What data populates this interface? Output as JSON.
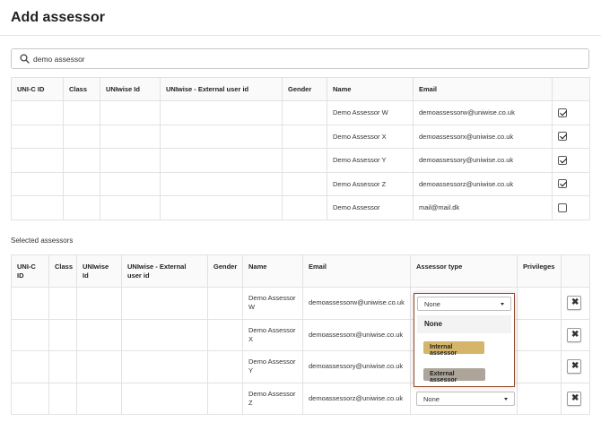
{
  "page": {
    "title": "Add assessor"
  },
  "search": {
    "value": "demo assessor",
    "icon": "search-icon"
  },
  "search_results": {
    "columns": [
      "UNI-C ID",
      "Class",
      "UNIwise Id",
      "UNIwise - External user id",
      "Gender",
      "Name",
      "Email",
      ""
    ],
    "rows": [
      {
        "uni_c_id": "",
        "class": "",
        "uniwise_id": "",
        "external_id": "",
        "gender": "",
        "name": "Demo Assessor W",
        "email": "demoassessorw@uniwise.co.uk",
        "checked": true
      },
      {
        "uni_c_id": "",
        "class": "",
        "uniwise_id": "",
        "external_id": "",
        "gender": "",
        "name": "Demo Assessor X",
        "email": "demoassessorx@uniwise.co.uk",
        "checked": true
      },
      {
        "uni_c_id": "",
        "class": "",
        "uniwise_id": "",
        "external_id": "",
        "gender": "",
        "name": "Demo Assessor Y",
        "email": "demoassessory@uniwise.co.uk",
        "checked": true
      },
      {
        "uni_c_id": "",
        "class": "",
        "uniwise_id": "",
        "external_id": "",
        "gender": "",
        "name": "Demo Assessor Z",
        "email": "demoassessorz@uniwise.co.uk",
        "checked": true
      },
      {
        "uni_c_id": "",
        "class": "",
        "uniwise_id": "",
        "external_id": "",
        "gender": "",
        "name": "Demo Assessor",
        "email": "mail@mail.dk",
        "checked": false
      }
    ]
  },
  "selected": {
    "label": "Selected assessors",
    "columns": [
      "UNI-C ID",
      "Class",
      "UNIwise Id",
      "UNIwise - External user id",
      "Gender",
      "Name",
      "Email",
      "Assessor type",
      "Privileges",
      ""
    ],
    "rows": [
      {
        "name": "Demo Assessor W",
        "email": "demoassessorw@uniwise.co.uk",
        "assessor_type": "None"
      },
      {
        "name": "Demo Assessor X",
        "email": "demoassessorx@uniwise.co.uk",
        "assessor_type": ""
      },
      {
        "name": "Demo Assessor Y",
        "email": "demoassessory@uniwise.co.uk",
        "assessor_type": ""
      },
      {
        "name": "Demo Assessor Z",
        "email": "demoassessorz@uniwise.co.uk",
        "assessor_type": "None"
      }
    ]
  },
  "assessor_type_dropdown": {
    "selected": "None",
    "options": [
      {
        "label": "None",
        "color": "#f3f3f3"
      },
      {
        "label": "Internal assessor",
        "color": "#d4b56a"
      },
      {
        "label": "External assessor",
        "color": "#aea59a"
      }
    ],
    "focus_color": "#8b4a2c"
  },
  "icons": {
    "remove": "close-icon",
    "dropdown": "chevron-down-icon"
  }
}
